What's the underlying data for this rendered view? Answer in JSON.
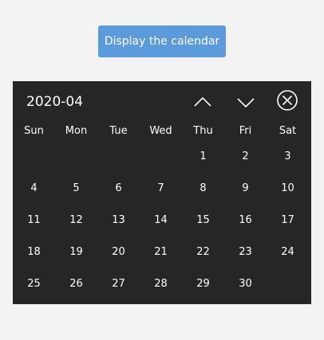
{
  "button": {
    "label": "Display the calendar"
  },
  "calendar": {
    "title": "2020-04",
    "controls": {
      "prev_icon": "chevron-up-icon",
      "next_icon": "chevron-down-icon",
      "close_icon": "close-circle-icon"
    },
    "weekdays": [
      "Sun",
      "Mon",
      "Tue",
      "Wed",
      "Thu",
      "Fri",
      "Sat"
    ],
    "leading_blanks": 4,
    "days": [
      "1",
      "2",
      "3",
      "4",
      "5",
      "6",
      "7",
      "8",
      "9",
      "10",
      "11",
      "12",
      "13",
      "14",
      "15",
      "16",
      "17",
      "18",
      "19",
      "20",
      "21",
      "22",
      "23",
      "24",
      "25",
      "26",
      "27",
      "28",
      "29",
      "30"
    ]
  },
  "colors": {
    "page_bg": "#f3f3f3",
    "button_bg": "#5b9bdc",
    "calendar_bg": "#262626",
    "text": "#ffffff"
  }
}
